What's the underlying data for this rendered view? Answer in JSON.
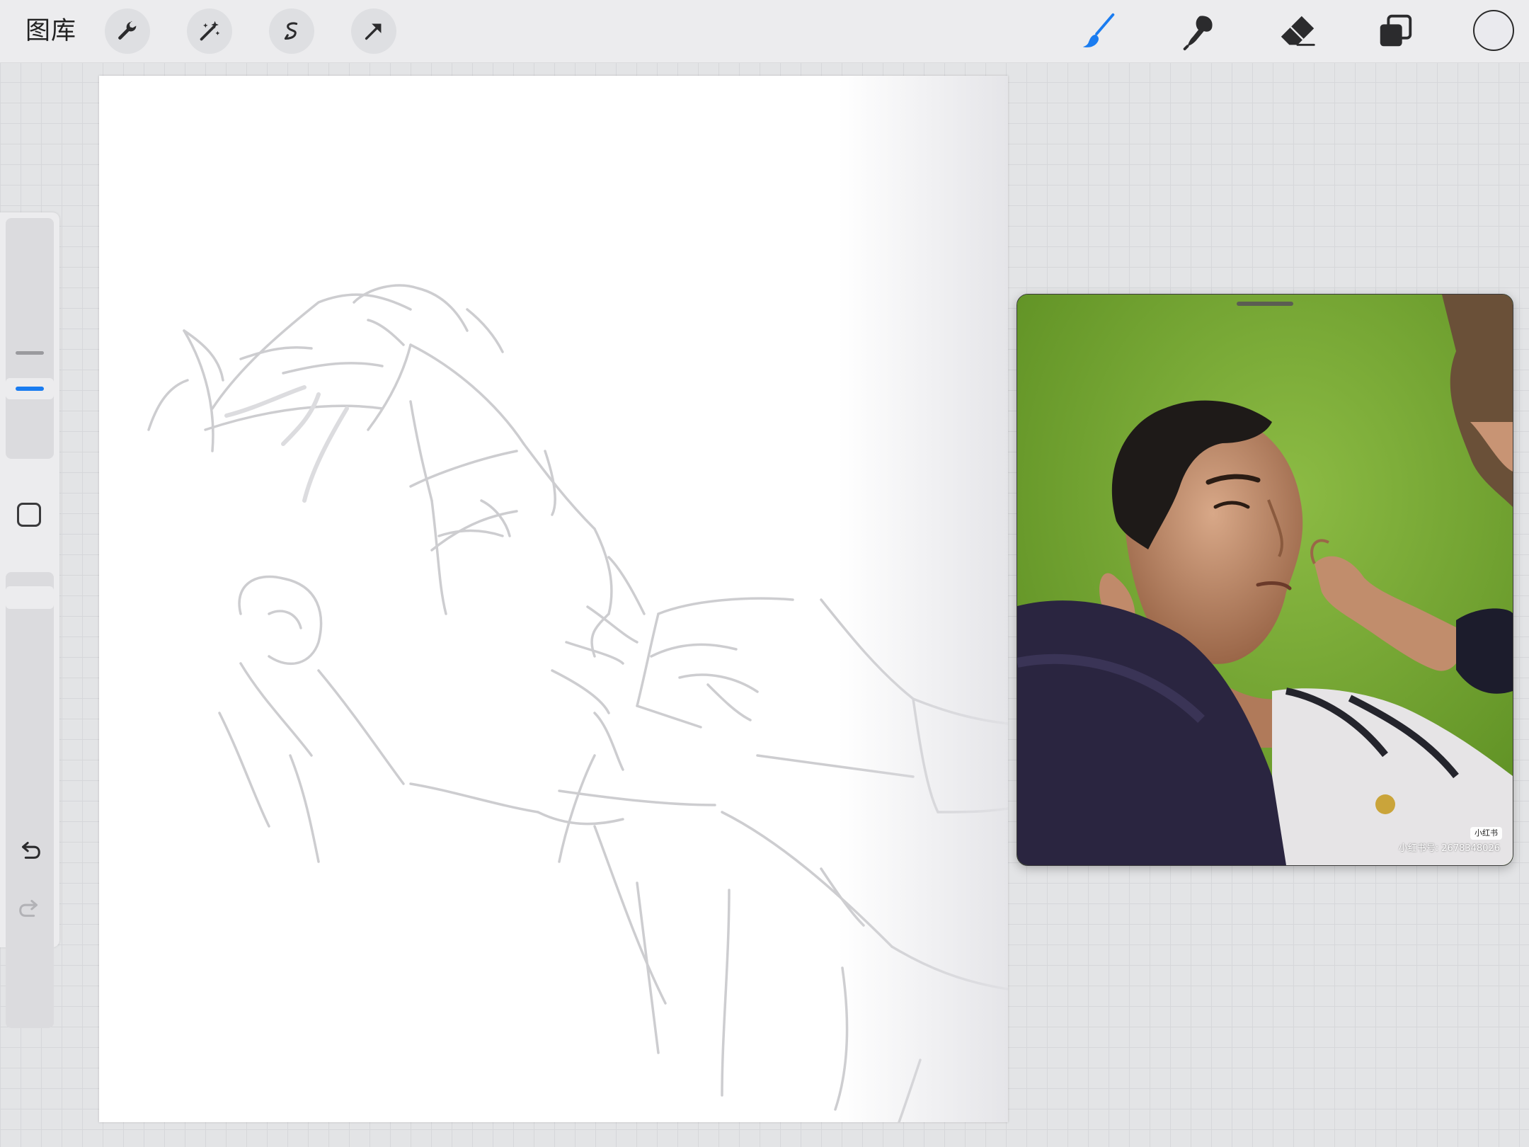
{
  "toolbar": {
    "gallery_label": "图库",
    "left_tools": [
      "wrench-icon",
      "magic-wand-icon",
      "selection-icon",
      "transform-arrow-icon"
    ],
    "right_tools": [
      "brush-icon",
      "smudge-icon",
      "eraser-icon",
      "layers-icon"
    ],
    "active_tool": "brush-icon",
    "accent_color": "#1a7cf0",
    "current_color": "#eaeaee"
  },
  "sidebar": {
    "brush_size_level": 0.38,
    "opacity_level": 1.0,
    "controls": [
      "size-slider",
      "modify-button",
      "opacity-slider",
      "undo-icon",
      "redo-icon"
    ]
  },
  "reference": {
    "watermark_tag": "小红书",
    "watermark_id": "小红书号: 2678348026"
  }
}
